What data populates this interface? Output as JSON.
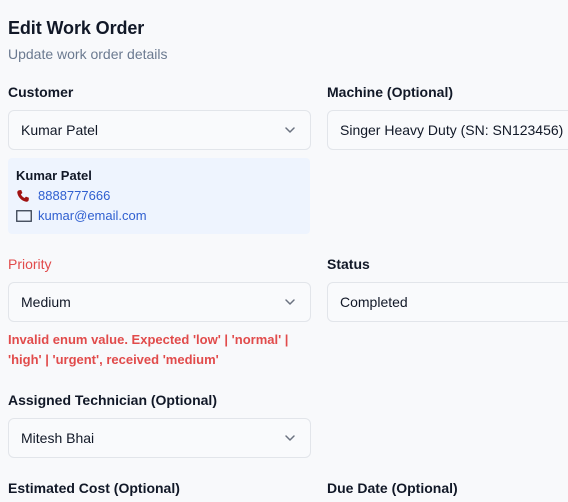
{
  "header": {
    "title": "Edit Work Order",
    "subtitle": "Update work order details"
  },
  "customer": {
    "label": "Customer",
    "value": "Kumar Patel",
    "card": {
      "name": "Kumar Patel",
      "phone": "8888777666",
      "email": "kumar@email.com"
    }
  },
  "machine": {
    "label": "Machine (Optional)",
    "value": "Singer Heavy Duty (SN: SN123456)"
  },
  "priority": {
    "label": "Priority",
    "value": "Medium",
    "error": "Invalid enum value. Expected 'low' | 'normal' | 'high' | 'urgent', received 'medium'"
  },
  "status": {
    "label": "Status",
    "value": "Completed"
  },
  "technician": {
    "label": "Assigned Technician (Optional)",
    "value": "Mitesh Bhai"
  },
  "estimated_cost": {
    "label": "Estimated Cost (Optional)"
  },
  "due_date": {
    "label": "Due Date (Optional)"
  },
  "colors": {
    "error": "#e14b4b",
    "link": "#2f5fd0",
    "card_bg": "#eef4fe"
  }
}
